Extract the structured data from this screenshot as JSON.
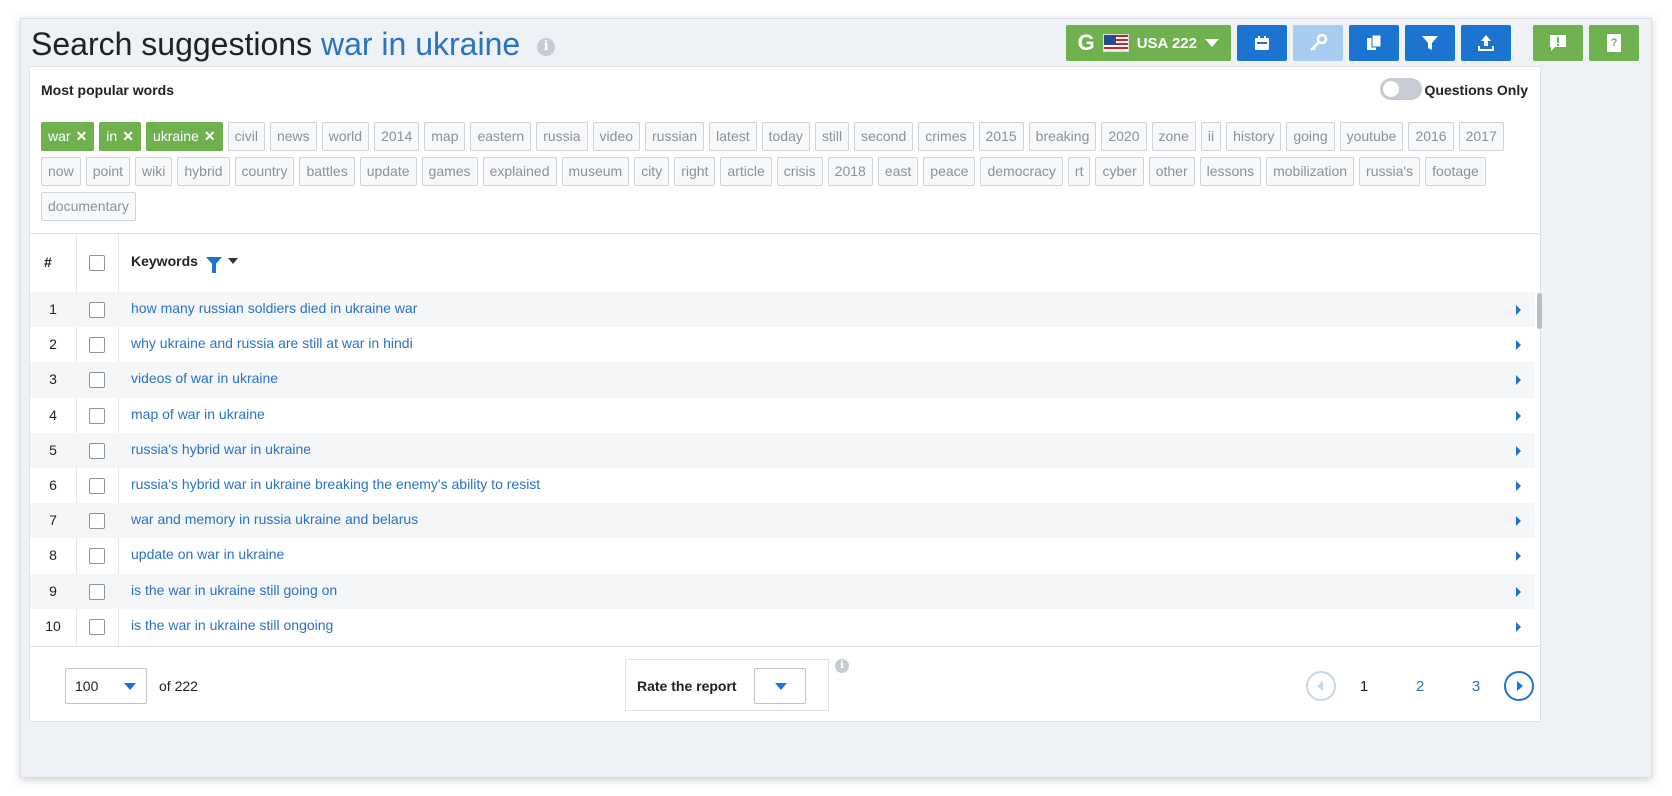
{
  "header": {
    "title_prefix": "Search suggestions",
    "title_query": "war in ukraine",
    "engine_letter": "G",
    "location_label": "USA 222"
  },
  "popular": {
    "title": "Most popular words",
    "questions_only_label": "Questions Only",
    "questions_only_on": false,
    "selected_tags": [
      "war",
      "in",
      "ukraine"
    ],
    "tags": [
      "civil",
      "news",
      "world",
      "2014",
      "map",
      "eastern",
      "russia",
      "video",
      "russian",
      "latest",
      "today",
      "still",
      "second",
      "crimes",
      "2015",
      "breaking",
      "2020",
      "zone",
      "ii",
      "history",
      "going",
      "youtube",
      "2016",
      "2017",
      "now",
      "point",
      "wiki",
      "hybrid",
      "country",
      "battles",
      "update",
      "games",
      "explained",
      "museum",
      "city",
      "right",
      "article",
      "crisis",
      "2018",
      "east",
      "peace",
      "democracy",
      "rt",
      "cyber",
      "other",
      "lessons",
      "mobilization",
      "russia's",
      "footage",
      "documentary"
    ]
  },
  "table": {
    "col_num": "#",
    "col_keywords": "Keywords",
    "rows": [
      {
        "num": "1",
        "keyword": "how many russian soldiers died in ukraine war"
      },
      {
        "num": "2",
        "keyword": "why ukraine and russia are still at war in hindi"
      },
      {
        "num": "3",
        "keyword": "videos of war in ukraine"
      },
      {
        "num": "4",
        "keyword": "map of war in ukraine"
      },
      {
        "num": "5",
        "keyword": "russia's hybrid war in ukraine"
      },
      {
        "num": "6",
        "keyword": "russia's hybrid war in ukraine breaking the enemy's ability to resist"
      },
      {
        "num": "7",
        "keyword": "war and memory in russia ukraine and belarus"
      },
      {
        "num": "8",
        "keyword": "update on war in ukraine"
      },
      {
        "num": "9",
        "keyword": "is the war in ukraine still going on"
      },
      {
        "num": "10",
        "keyword": "is the war in ukraine still ongoing"
      }
    ]
  },
  "footer": {
    "per_page": "100",
    "of_total": "of 222",
    "rate_label": "Rate the report",
    "pages": [
      "1",
      "2",
      "3"
    ],
    "current_page": "1"
  },
  "colors": {
    "accent_blue": "#1b75d0",
    "link_blue": "#2a73c4",
    "green": "#6fb14f"
  }
}
